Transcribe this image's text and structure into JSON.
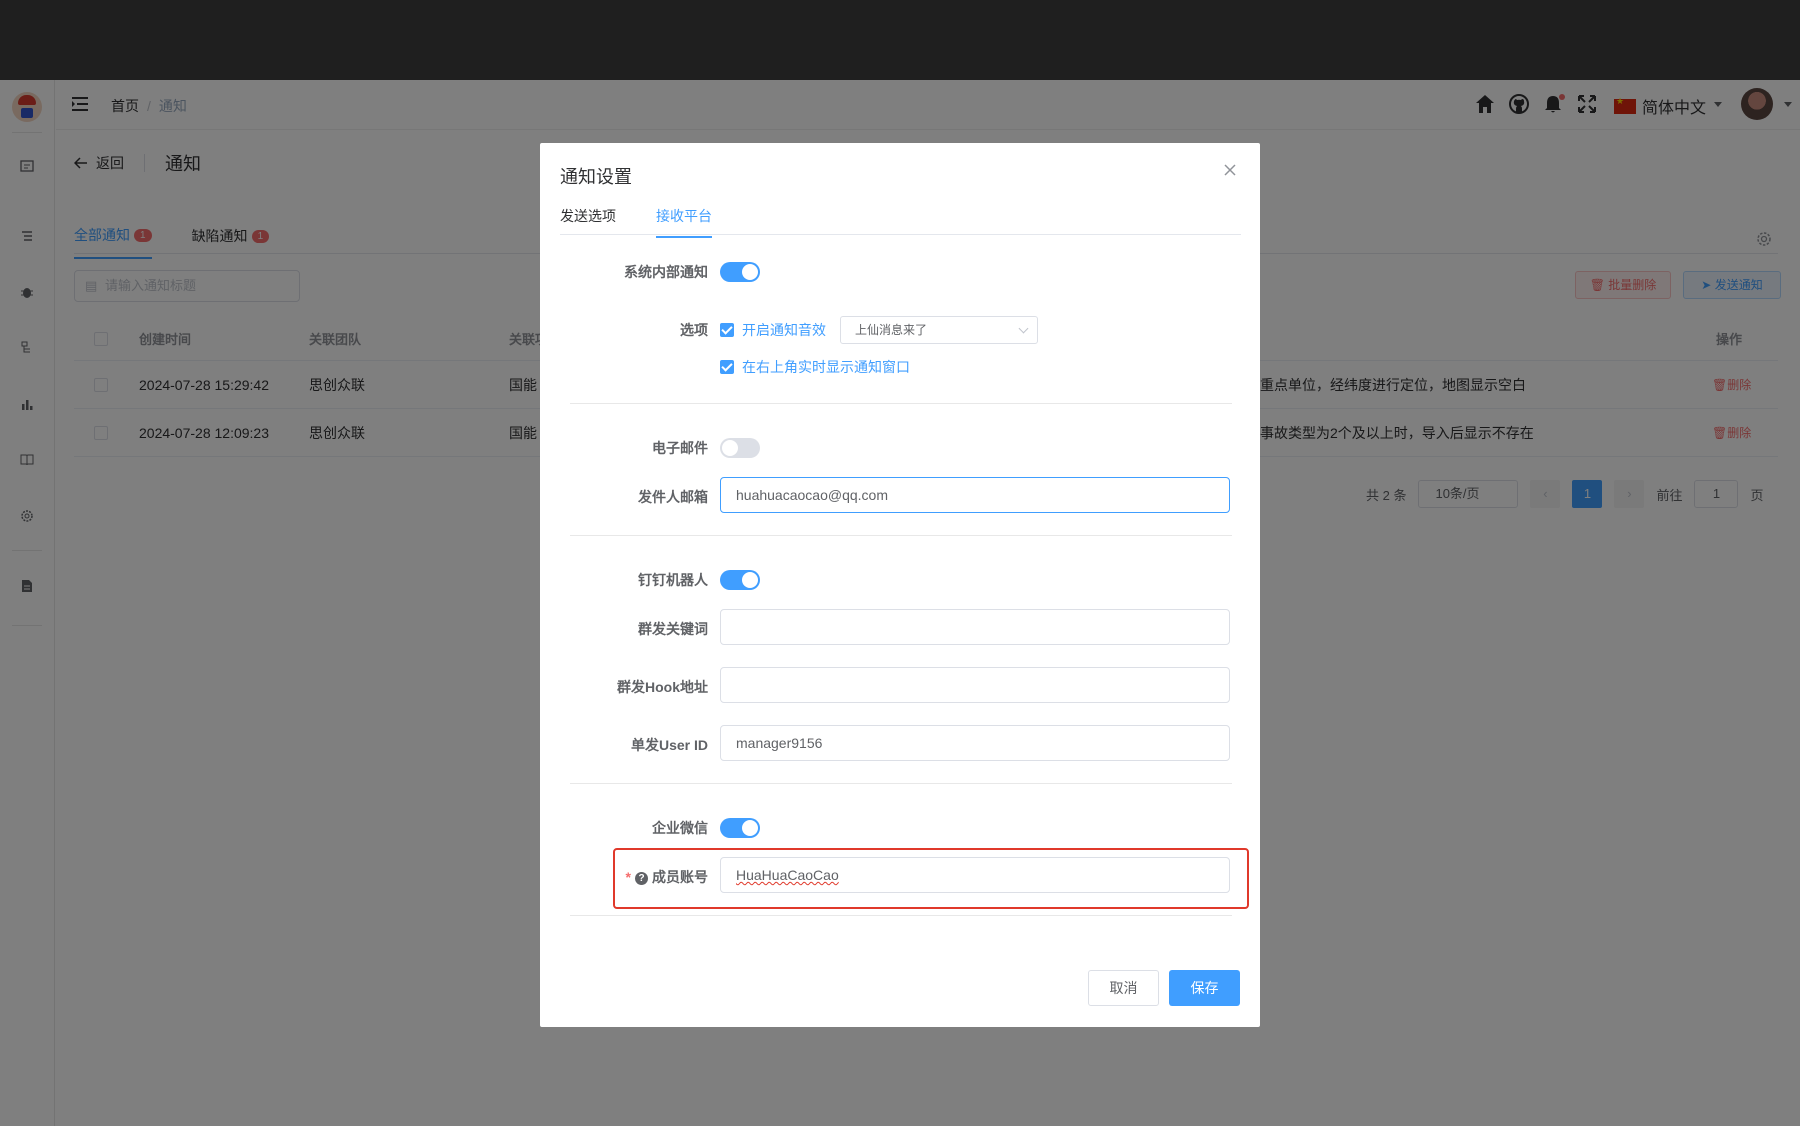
{
  "header": {
    "breadcrumb": {
      "home": "首页",
      "separator": "/",
      "current": "通知"
    },
    "language": "简体中文"
  },
  "page": {
    "back_label": "返回",
    "title": "通知",
    "tabs": [
      {
        "label": "全部通知",
        "badge": "1"
      },
      {
        "label": "缺陷通知",
        "badge": "1"
      }
    ],
    "search_placeholder": "请输入通知标题",
    "batch_delete_label": "批量删除",
    "send_label": "发送通知"
  },
  "table": {
    "columns": {
      "created": "创建时间",
      "team": "关联团队",
      "related": "关联项",
      "action": "操作"
    },
    "rows": [
      {
        "created": "2024-07-28 15:29:42",
        "team": "思创众联",
        "related": "国能",
        "content": "重点单位，经纬度进行定位，地图显示空白",
        "action": "删除"
      },
      {
        "created": "2024-07-28 12:09:23",
        "team": "思创众联",
        "related": "国能",
        "content": "事故类型为2个及以上时，导入后显示不存在",
        "action": "删除"
      }
    ]
  },
  "pagination": {
    "total": "共 2 条",
    "page_size": "10条/页",
    "prev": "‹",
    "current_page": "1",
    "next": "›",
    "goto_label": "前往",
    "goto_value": "1",
    "goto_suffix": "页"
  },
  "dialog": {
    "title": "通知设置",
    "tabs": [
      "发送选项",
      "接收平台"
    ],
    "active_tab": 1,
    "internal": {
      "label": "系统内部通知",
      "enabled": true
    },
    "options": {
      "label": "选项",
      "sound_label": "开启通知音效",
      "sound_checked": true,
      "sound_select": "上仙消息来了",
      "popup_label": "在右上角实时显示通知窗口",
      "popup_checked": true
    },
    "email": {
      "label": "电子邮件",
      "enabled": false,
      "sender_label": "发件人邮箱",
      "sender_value": "huahuacaocao@qq.com"
    },
    "dingtalk": {
      "label": "钉钉机器人",
      "enabled": true,
      "keyword_label": "群发关键词",
      "keyword_value": "",
      "hook_label": "群发Hook地址",
      "hook_value": "",
      "userid_label": "单发User ID",
      "userid_value": "manager9156"
    },
    "wecom": {
      "label": "企业微信",
      "enabled": true,
      "required_mark": "*",
      "member_label": "成员账号",
      "member_value": "HuaHuaCaoCao"
    },
    "cancel_label": "取消",
    "save_label": "保存"
  },
  "colors": {
    "primary": "#409eff",
    "danger": "#f56c6c",
    "highlight": "#e0392b",
    "mask": "rgba(0,0,0,0.5)"
  }
}
